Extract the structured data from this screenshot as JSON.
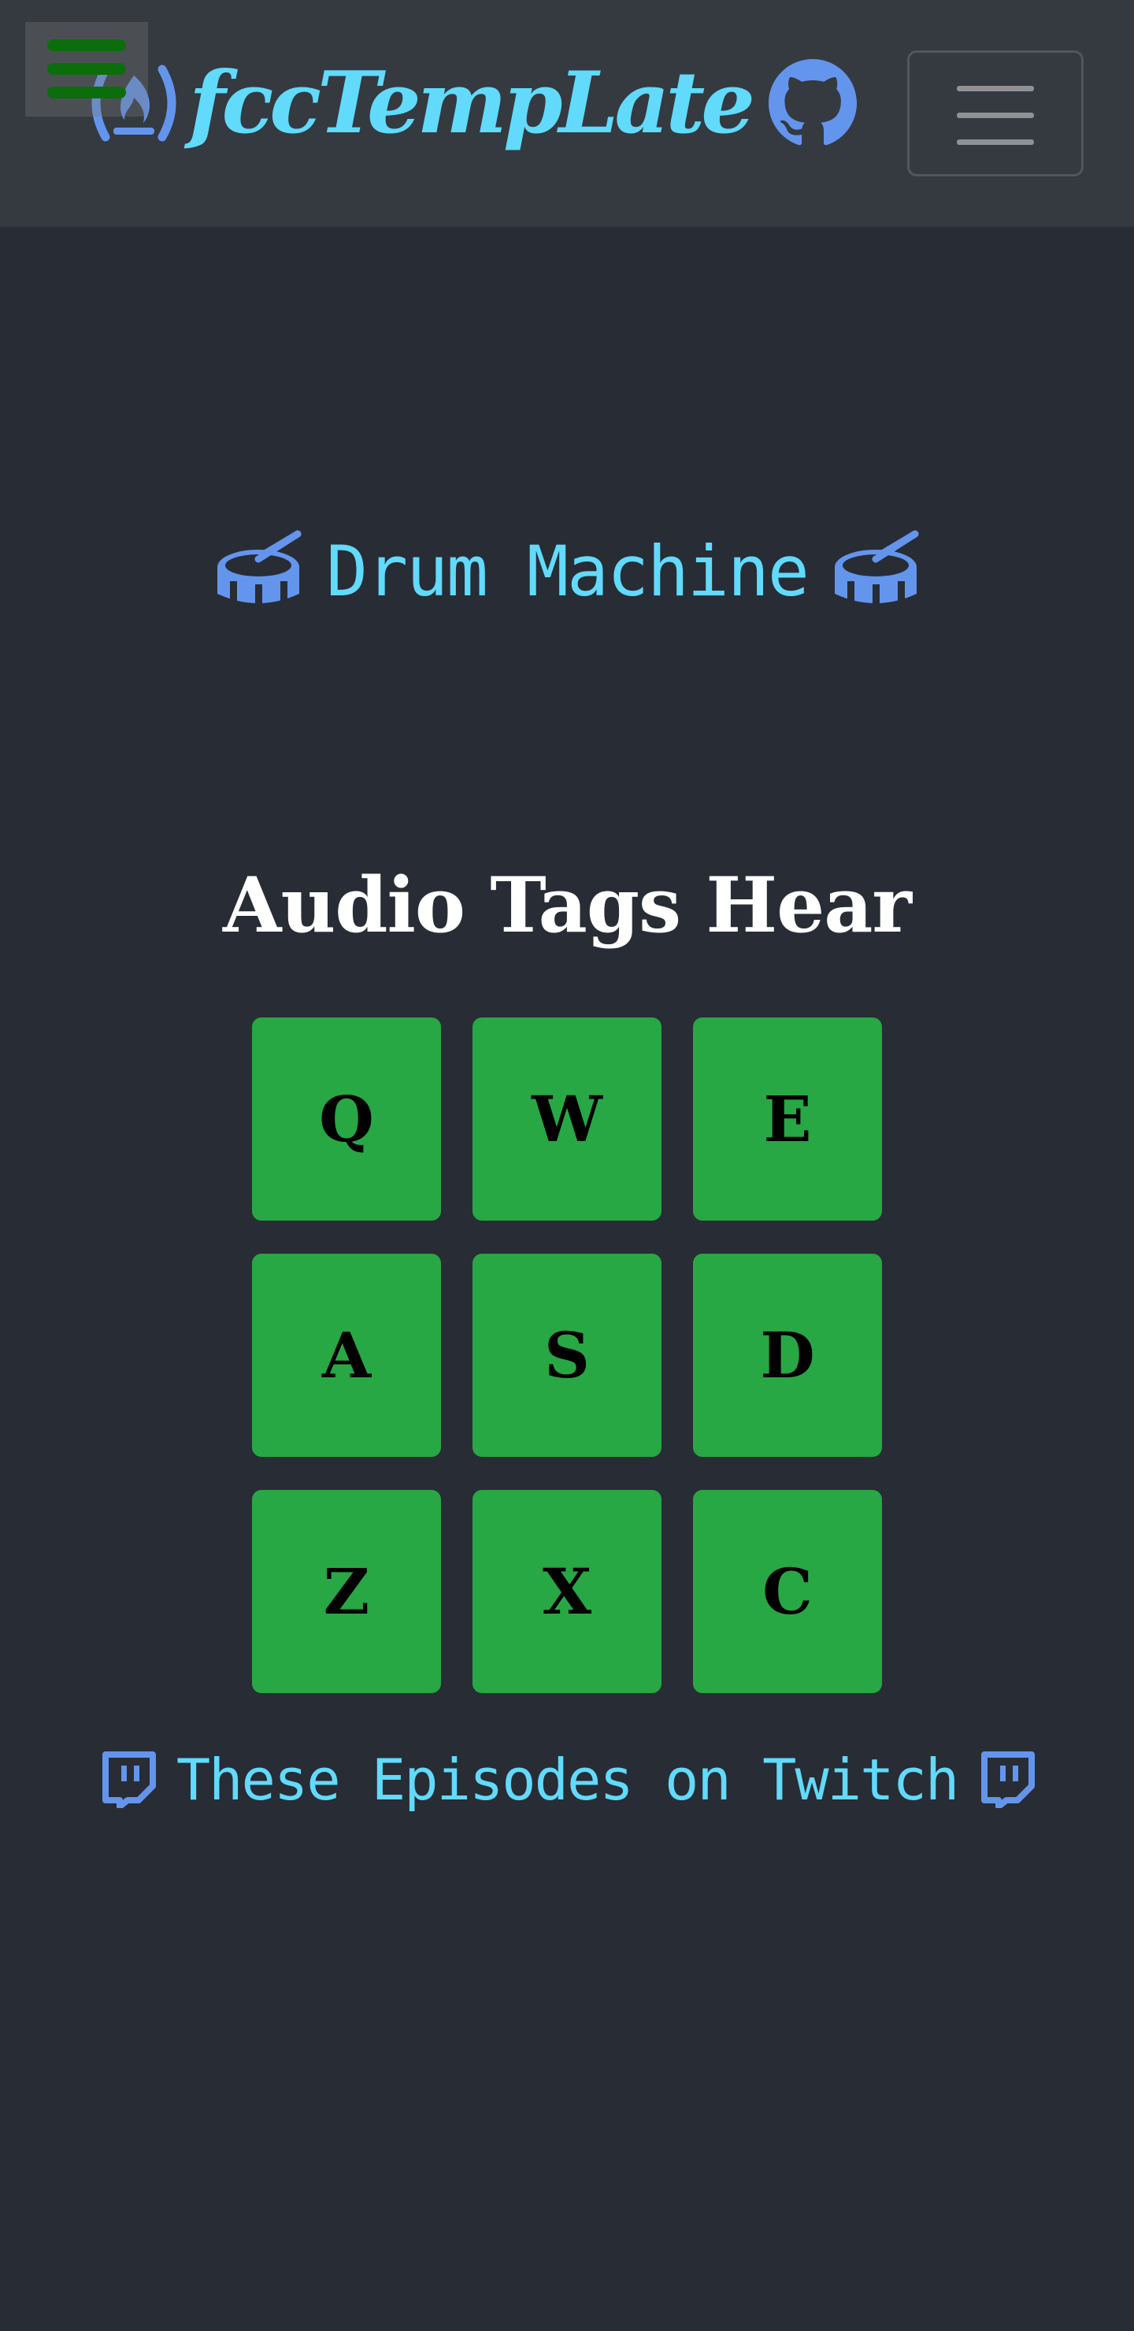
{
  "colors": {
    "background": "#282c34",
    "navbar": "#343a40",
    "accent": "#61dafb",
    "icon_blue": "#6495ed",
    "pad_green": "#28a745",
    "hamburger_green": "#0c6d0c"
  },
  "navbar": {
    "brand_text": "fccTempLate",
    "brand_logo_icon": "freecodecamp-icon",
    "github_icon": "github-icon",
    "menu_overlay_icon": "hamburger-icon",
    "toggler_icon": "navbar-toggler-icon"
  },
  "main": {
    "title": "Drum Machine",
    "title_icon": "drum-icon",
    "subtitle": "Audio Tags Hear",
    "pads": [
      {
        "key": "Q"
      },
      {
        "key": "W"
      },
      {
        "key": "E"
      },
      {
        "key": "A"
      },
      {
        "key": "S"
      },
      {
        "key": "D"
      },
      {
        "key": "Z"
      },
      {
        "key": "X"
      },
      {
        "key": "C"
      }
    ],
    "twitch_link": "These Episodes on Twitch",
    "twitch_icon": "twitch-icon"
  }
}
